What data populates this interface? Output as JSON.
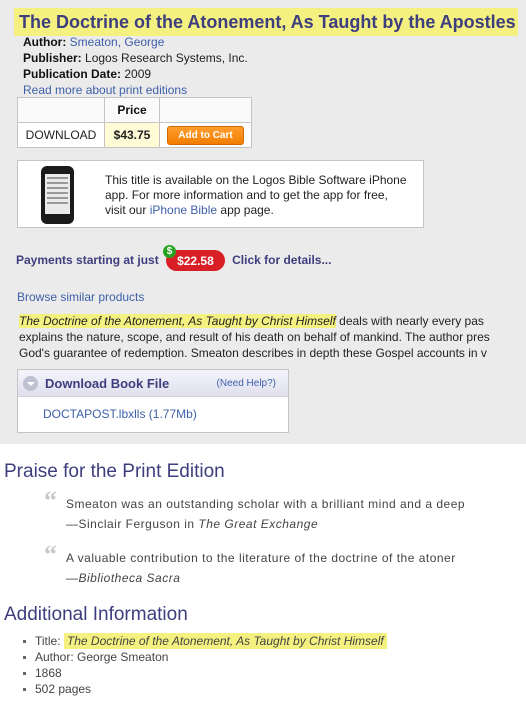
{
  "product": {
    "title": "The Doctrine of the Atonement, As Taught by the Apostles",
    "author_label": "Author:",
    "author": "Smeaton, George",
    "publisher_label": "Publisher:",
    "publisher": "Logos Research Systems, Inc.",
    "pubdate_label": "Publication Date:",
    "pubdate": "2009",
    "print_editions_link": "Read more about print editions"
  },
  "price_table": {
    "header_price": "Price",
    "format": "DOWNLOAD",
    "price": "$43.75",
    "add_to_cart": "Add to Cart"
  },
  "iphone": {
    "line1": "This title is available on the Logos Bible Software iPhone",
    "line2": "app. For more information and to get the app for free,",
    "line3_prefix": "visit our",
    "link": "iPhone Bible",
    "line3_suffix": "app page."
  },
  "payments": {
    "label": "Payments starting at just",
    "amount": "$22.58",
    "dollar_sign": "$",
    "details_link": "Click for details..."
  },
  "browse_link": "Browse similar products",
  "description": {
    "title_highlight": "The Doctrine of the Atonement, As Taught by Christ Himself",
    "line1_rest": " deals with nearly every pas",
    "line2": "explains the nature, scope, and result of his death on behalf of mankind. The author pres",
    "line3": "God's guarantee of redemption. Smeaton describes in depth these Gospel accounts in v"
  },
  "download": {
    "title": "Download Book File",
    "help": "(Need Help?)",
    "file": "DOCTAPOST.lbxlls (1.77Mb)"
  },
  "praise": {
    "heading": "Praise for the Print Edition",
    "quotes": [
      {
        "mark": "“",
        "text": "Smeaton was an outstanding scholar with a brilliant mind and a deep",
        "attr_prefix": "—Sinclair Ferguson in ",
        "attr_italic": "The Great Exchange"
      },
      {
        "mark": "“",
        "text": "A valuable contribution to the literature of the doctrine of the atoner",
        "attr_prefix": "—",
        "attr_italic": "Bibliotheca Sacra"
      }
    ]
  },
  "additional": {
    "heading": "Additional Information",
    "title_label": "Title:",
    "title": "The Doctrine of the Atonement, As Taught by Christ Himself",
    "author": "Author: George Smeaton",
    "year": "1868",
    "pages": "502 pages"
  },
  "icons": {
    "phone": "iphone-device-icon",
    "expand": "chevron-down-icon",
    "quote": "quote-mark-icon",
    "dollar": "dollar-badge-icon"
  },
  "colors": {
    "highlight": "#f4f181",
    "heading": "#3e3e7e",
    "link": "#3d5fa8",
    "cart_button": "#f27d00",
    "pay_badge": "#d81f26",
    "panel": "#ebebeb"
  }
}
